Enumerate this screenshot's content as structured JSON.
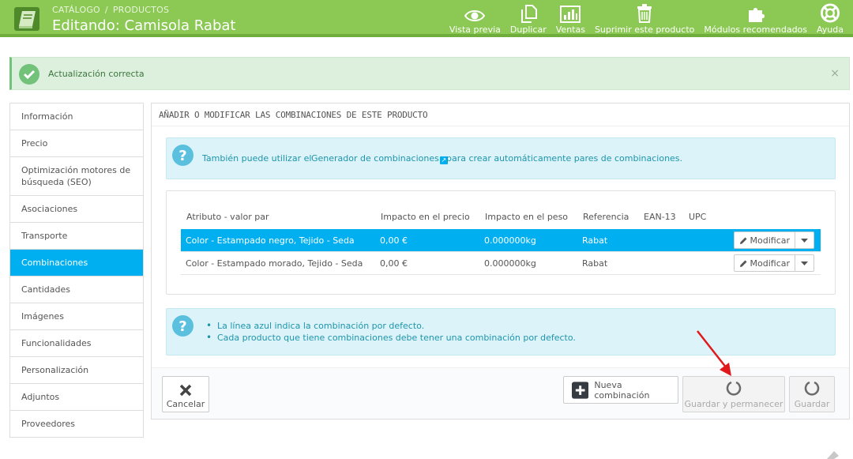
{
  "colors": {
    "header_bg": "#8bc954",
    "accent_blue": "#00aff0",
    "alert_bg": "#ddf0de",
    "info_bg": "#dcf4f9",
    "arrow_red": "#e0191c"
  },
  "header": {
    "breadcrumb": [
      "CATÁLOGO",
      "PRODUCTOS"
    ],
    "breadcrumb_separator": "/",
    "title": "Editando: Camisola Rabat",
    "toolbar": [
      {
        "label": "Vista previa",
        "icon": "eye-icon"
      },
      {
        "label": "Duplicar",
        "icon": "copy-icon"
      },
      {
        "label": "Ventas",
        "icon": "bar-chart-icon"
      },
      {
        "label": "Suprimir este producto",
        "icon": "trash-icon"
      },
      {
        "label": "Módulos recomendados",
        "icon": "puzzle-icon"
      },
      {
        "label": "Ayuda",
        "icon": "lifebuoy-icon"
      }
    ]
  },
  "alert": {
    "text": "Actualización correcta",
    "close": "×"
  },
  "sidebar": {
    "items": [
      {
        "label": "Información"
      },
      {
        "label": "Precio"
      },
      {
        "label": "Optimización motores de búsqueda (SEO)"
      },
      {
        "label": "Asociaciones"
      },
      {
        "label": "Transporte"
      },
      {
        "label": "Combinaciones",
        "active": true
      },
      {
        "label": "Cantidades"
      },
      {
        "label": "Imágenes"
      },
      {
        "label": "Funcionalidades"
      },
      {
        "label": "Personalización"
      },
      {
        "label": "Adjuntos"
      },
      {
        "label": "Proveedores"
      }
    ]
  },
  "panel": {
    "heading": "AÑADIR O MODIFICAR LAS COMBINACIONES DE ESTE PRODUCTO",
    "info_top": {
      "before": "También puede utilizar el",
      "link": "Generador de combinaciones",
      "after": "para crear automáticamente pares de combinaciones."
    },
    "table": {
      "headers": [
        "Atributo - valor par",
        "Impacto en el precio",
        "Impacto en el peso",
        "Referencia",
        "EAN-13",
        "UPC"
      ],
      "rows": [
        {
          "attribute": "Color - Estampado negro, Tejido - Seda",
          "price": "0,00 €",
          "weight": "0.000000kg",
          "reference": "Rabat",
          "ean13": "",
          "upc": "",
          "default": true
        },
        {
          "attribute": "Color - Estampado morado, Tejido - Seda",
          "price": "0,00 €",
          "weight": "0.000000kg",
          "reference": "Rabat",
          "ean13": "",
          "upc": "",
          "default": false
        }
      ],
      "modify_label": "Modificar"
    },
    "info_bottom": [
      "La línea azul indica la combinación por defecto.",
      "Cada producto que tiene combinaciones debe tener una combinación por defecto."
    ],
    "footer": {
      "cancel": "Cancelar",
      "new_combination": "Nueva combinación",
      "save_stay": "Guardar y permanecer",
      "save": "Guardar"
    }
  }
}
